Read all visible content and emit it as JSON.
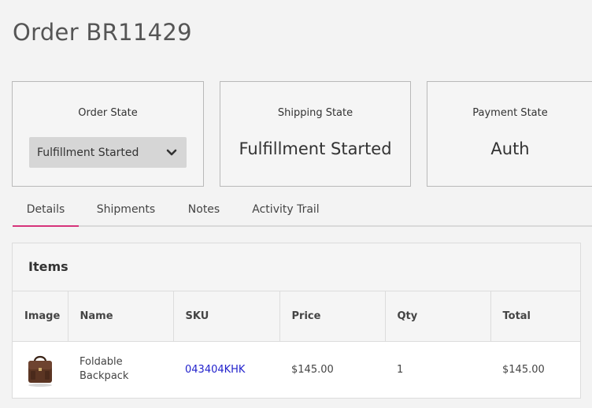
{
  "page": {
    "title": "Order BR11429"
  },
  "cards": {
    "order_state": {
      "label": "Order State",
      "value": "Fulfillment Started"
    },
    "shipping_state": {
      "label": "Shipping State",
      "value": "Fulfillment Started"
    },
    "payment_state": {
      "label": "Payment State",
      "value": "Auth"
    }
  },
  "tabs": [
    {
      "label": "Details",
      "active": true
    },
    {
      "label": "Shipments",
      "active": false
    },
    {
      "label": "Notes",
      "active": false
    },
    {
      "label": "Activity Trail",
      "active": false
    }
  ],
  "items": {
    "title": "Items",
    "columns": [
      "Image",
      "Name",
      "SKU",
      "Price",
      "Qty",
      "Total"
    ],
    "rows": [
      {
        "image_icon": "backpack-image",
        "name": "Foldable Backpack",
        "sku": "043404KHK",
        "price": "$145.00",
        "qty": "1",
        "total": "$145.00"
      }
    ]
  },
  "colors": {
    "accent_tab": "#d6337a",
    "link": "#2222cc"
  }
}
